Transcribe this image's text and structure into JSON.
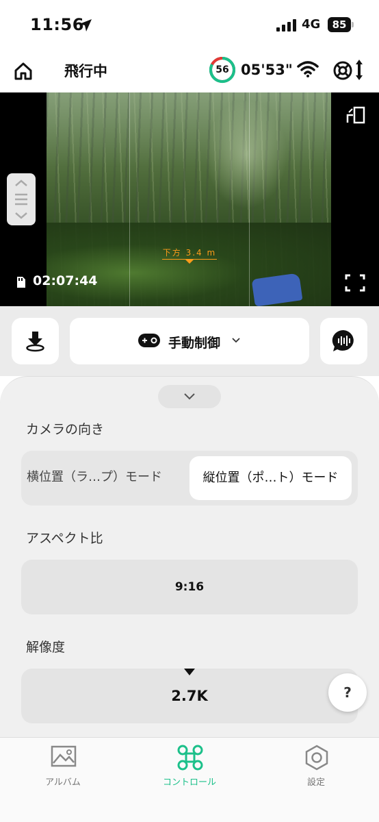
{
  "status_bar": {
    "time": "11:56",
    "network": "4G",
    "battery": "85"
  },
  "header": {
    "flight_status": "飛行中",
    "satellite_count": "56",
    "flight_time": "05'53\"",
    "accent_color": "#1cc08a"
  },
  "camera": {
    "height_label": "下方 3.4 m",
    "record_time": "02:07:44"
  },
  "controls": {
    "mode_label": "手動制御"
  },
  "panel": {
    "orientation": {
      "label": "カメラの向き",
      "options": [
        "横位置（ラ…プ）モード",
        "縦位置（ポ…ト）モード"
      ],
      "selected": "縦位置（ポ…ト）モード"
    },
    "aspect": {
      "label": "アスペクト比",
      "value": "9:16"
    },
    "resolution": {
      "label": "解像度",
      "value": "2.7K"
    },
    "help_label": "?"
  },
  "tabs": [
    {
      "label": "アルバム",
      "icon": "image-icon"
    },
    {
      "label": "コントロール",
      "icon": "drone-icon",
      "active": true
    },
    {
      "label": "設定",
      "icon": "hexagon-settings-icon"
    }
  ]
}
